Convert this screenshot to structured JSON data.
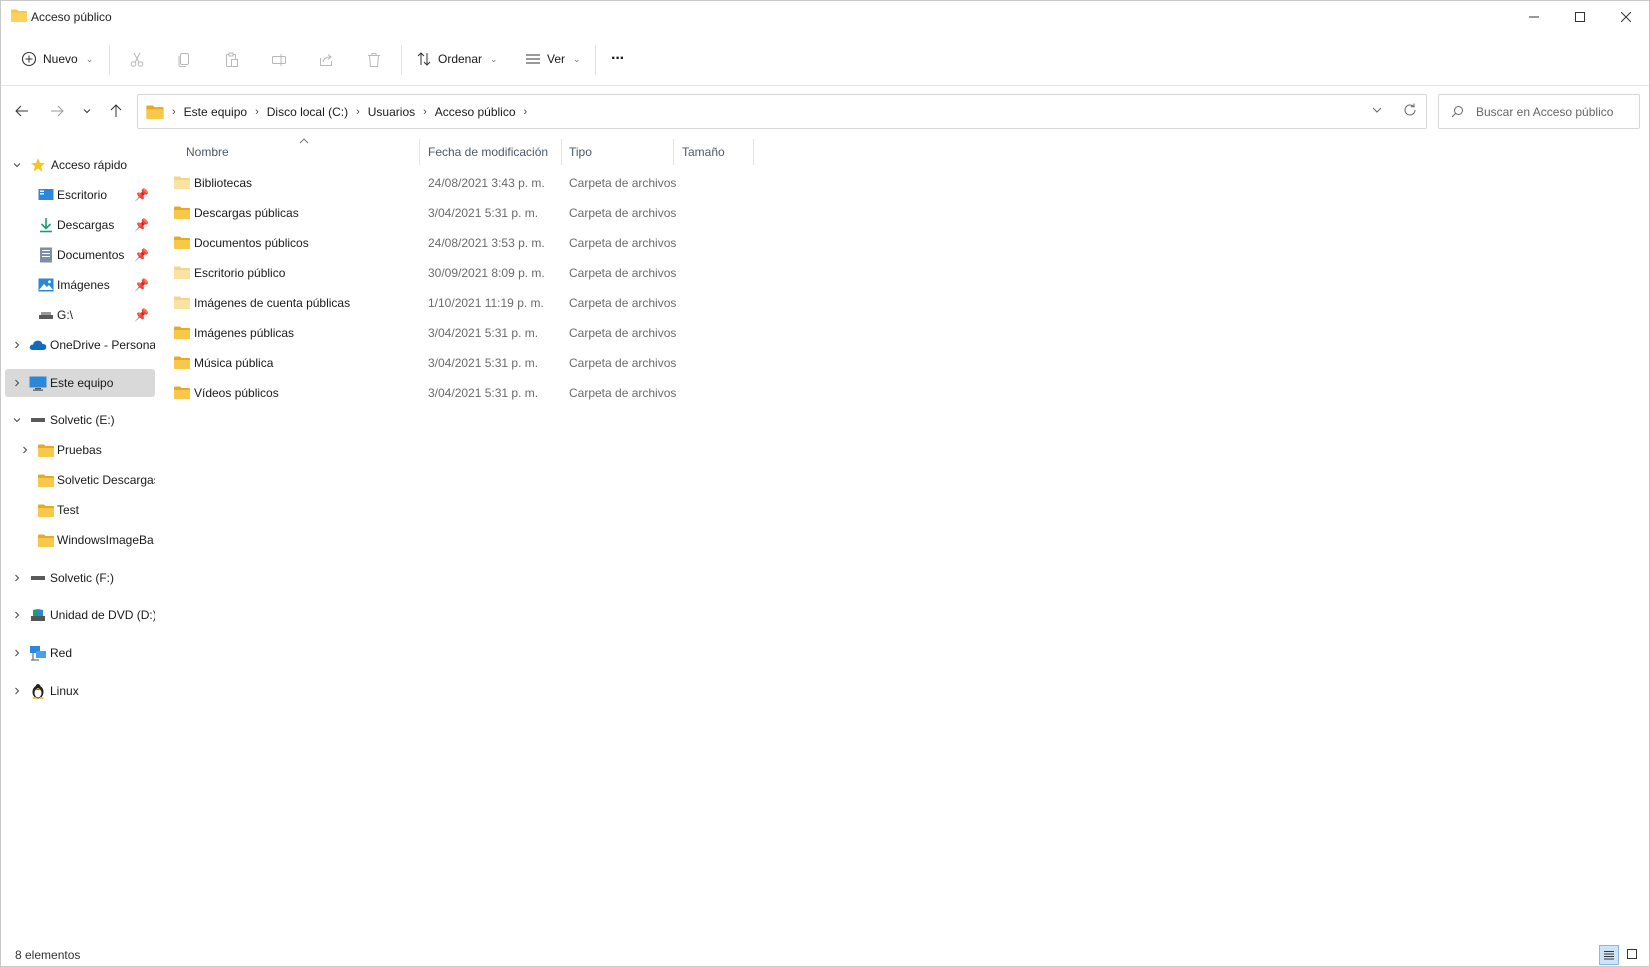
{
  "window": {
    "title": "Acceso público"
  },
  "commandbar": {
    "new_label": "Nuevo",
    "sort_label": "Ordenar",
    "view_label": "Ver",
    "more_label": "···"
  },
  "address": {
    "crumbs": [
      "Este equipo",
      "Disco local (C:)",
      "Usuarios",
      "Acceso público"
    ]
  },
  "search": {
    "placeholder": "Buscar en Acceso público"
  },
  "sidebar": {
    "items": [
      {
        "label": "Acceso rápido",
        "icon": "star-icon"
      },
      {
        "label": "Escritorio",
        "icon": "desktop-icon"
      },
      {
        "label": "Descargas",
        "icon": "download-icon"
      },
      {
        "label": "Documentos",
        "icon": "document-icon"
      },
      {
        "label": "Imágenes",
        "icon": "image-icon"
      },
      {
        "label": "G:\\",
        "icon": "drive-icon"
      },
      {
        "label": "OneDrive - Personal",
        "icon": "cloud-icon"
      },
      {
        "label": "Este equipo",
        "icon": "monitor-icon"
      },
      {
        "label": "Solvetic (E:)",
        "icon": "drive-icon"
      },
      {
        "label": "Pruebas",
        "icon": "folder-icon"
      },
      {
        "label": "Solvetic Descargas",
        "icon": "folder-icon"
      },
      {
        "label": "Test",
        "icon": "folder-icon"
      },
      {
        "label": "WindowsImageBa",
        "icon": "folder-icon"
      },
      {
        "label": "Solvetic (F:)",
        "icon": "drive-icon"
      },
      {
        "label": "Unidad de DVD (D:)",
        "icon": "dvd-icon"
      },
      {
        "label": "Red",
        "icon": "network-icon"
      },
      {
        "label": "Linux",
        "icon": "linux-icon"
      }
    ]
  },
  "columns": {
    "name": "Nombre",
    "date": "Fecha de modificación",
    "type": "Tipo",
    "size": "Tamaño"
  },
  "files": [
    {
      "name": "Bibliotecas",
      "date": "24/08/2021 3:43 p. m.",
      "type": "Carpeta de archivos"
    },
    {
      "name": "Descargas públicas",
      "date": "3/04/2021 5:31 p. m.",
      "type": "Carpeta de archivos"
    },
    {
      "name": "Documentos públicos",
      "date": "24/08/2021 3:53 p. m.",
      "type": "Carpeta de archivos"
    },
    {
      "name": "Escritorio público",
      "date": "30/09/2021 8:09 p. m.",
      "type": "Carpeta de archivos"
    },
    {
      "name": "Imágenes de cuenta públicas",
      "date": "1/10/2021 11:19 p. m.",
      "type": "Carpeta de archivos"
    },
    {
      "name": "Imágenes públicas",
      "date": "3/04/2021 5:31 p. m.",
      "type": "Carpeta de archivos"
    },
    {
      "name": "Música pública",
      "date": "3/04/2021 5:31 p. m.",
      "type": "Carpeta de archivos"
    },
    {
      "name": "Vídeos públicos",
      "date": "3/04/2021 5:31 p. m.",
      "type": "Carpeta de archivos"
    }
  ],
  "status": {
    "count": "8 elementos"
  },
  "colors": {
    "folder": "#f8c84a",
    "folder_dark": "#e8a91e",
    "selection": "#d9d9d9",
    "accent": "#0067c0"
  }
}
